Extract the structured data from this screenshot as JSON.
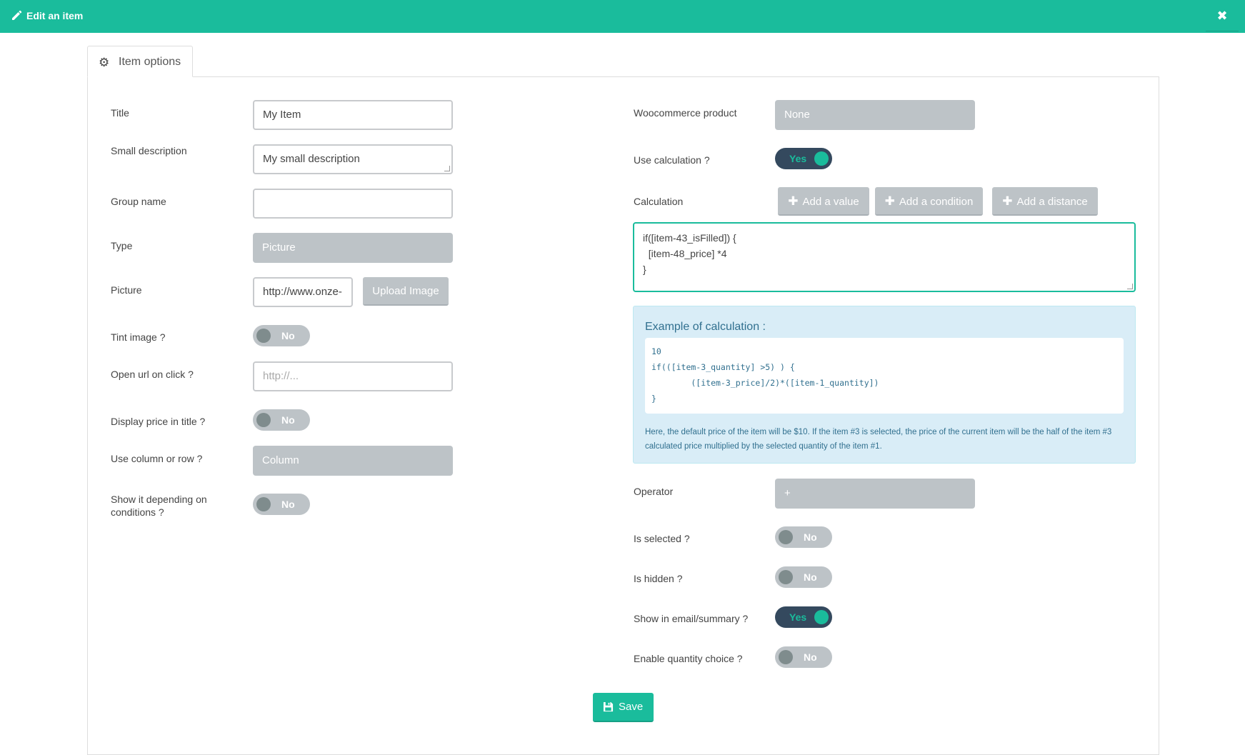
{
  "header": {
    "title": "Edit an item",
    "close_label": "✖"
  },
  "tab": {
    "label": "Item options"
  },
  "left": {
    "title": {
      "label": "Title",
      "value": "My Item"
    },
    "small_description": {
      "label": "Small description",
      "value": "My small description"
    },
    "group_name": {
      "label": "Group name",
      "value": ""
    },
    "type": {
      "label": "Type",
      "value": "Picture"
    },
    "picture": {
      "label": "Picture",
      "value": "http://www.onze-",
      "upload_label": "Upload Image"
    },
    "tint_image": {
      "label": "Tint image ?",
      "state": "No"
    },
    "open_url": {
      "label": "Open url on click ?",
      "placeholder": "http://..."
    },
    "display_price": {
      "label": "Display price in title ?",
      "state": "No"
    },
    "column_row": {
      "label": "Use column or row ?",
      "value": "Column"
    },
    "show_conditions": {
      "label_line1": "Show it depending on",
      "label_line2": "conditions ?",
      "state": "No"
    }
  },
  "right": {
    "woocommerce": {
      "label": "Woocommerce product",
      "value": "None"
    },
    "use_calculation": {
      "label": "Use calculation ?",
      "state": "Yes"
    },
    "calculation": {
      "label": "Calculation",
      "add_value": "Add a value",
      "add_condition": "Add a condition",
      "add_distance": "Add a distance",
      "lines": [
        "if([item-43_isFilled]) {",
        "  [item-48_price] *4",
        "}"
      ]
    },
    "example": {
      "title": "Example of calculation :",
      "code_lines": [
        "10",
        "if(([item-3_quantity] >5) ) {",
        "        ([item-3_price]/2)*([item-1_quantity])",
        "}"
      ],
      "note": "Here, the default price of the item will be $10. If the item #3 is selected, the price of the current item will be the half of the item #3 calculated price multiplied by the selected quantity of the item #1."
    },
    "operator": {
      "label": "Operator",
      "value": "+"
    },
    "is_selected": {
      "label": "Is selected ?",
      "state": "No"
    },
    "is_hidden": {
      "label": "Is hidden ?",
      "state": "No"
    },
    "show_email": {
      "label": "Show in email/summary ?",
      "state": "Yes"
    },
    "quantity_choice": {
      "label": "Enable quantity choice ?",
      "state": "No"
    }
  },
  "save_label": "Save",
  "colors": {
    "accent": "#1abc9c",
    "grey": "#bdc3c7",
    "dark": "#34495e",
    "info_bg": "#d9edf7"
  }
}
